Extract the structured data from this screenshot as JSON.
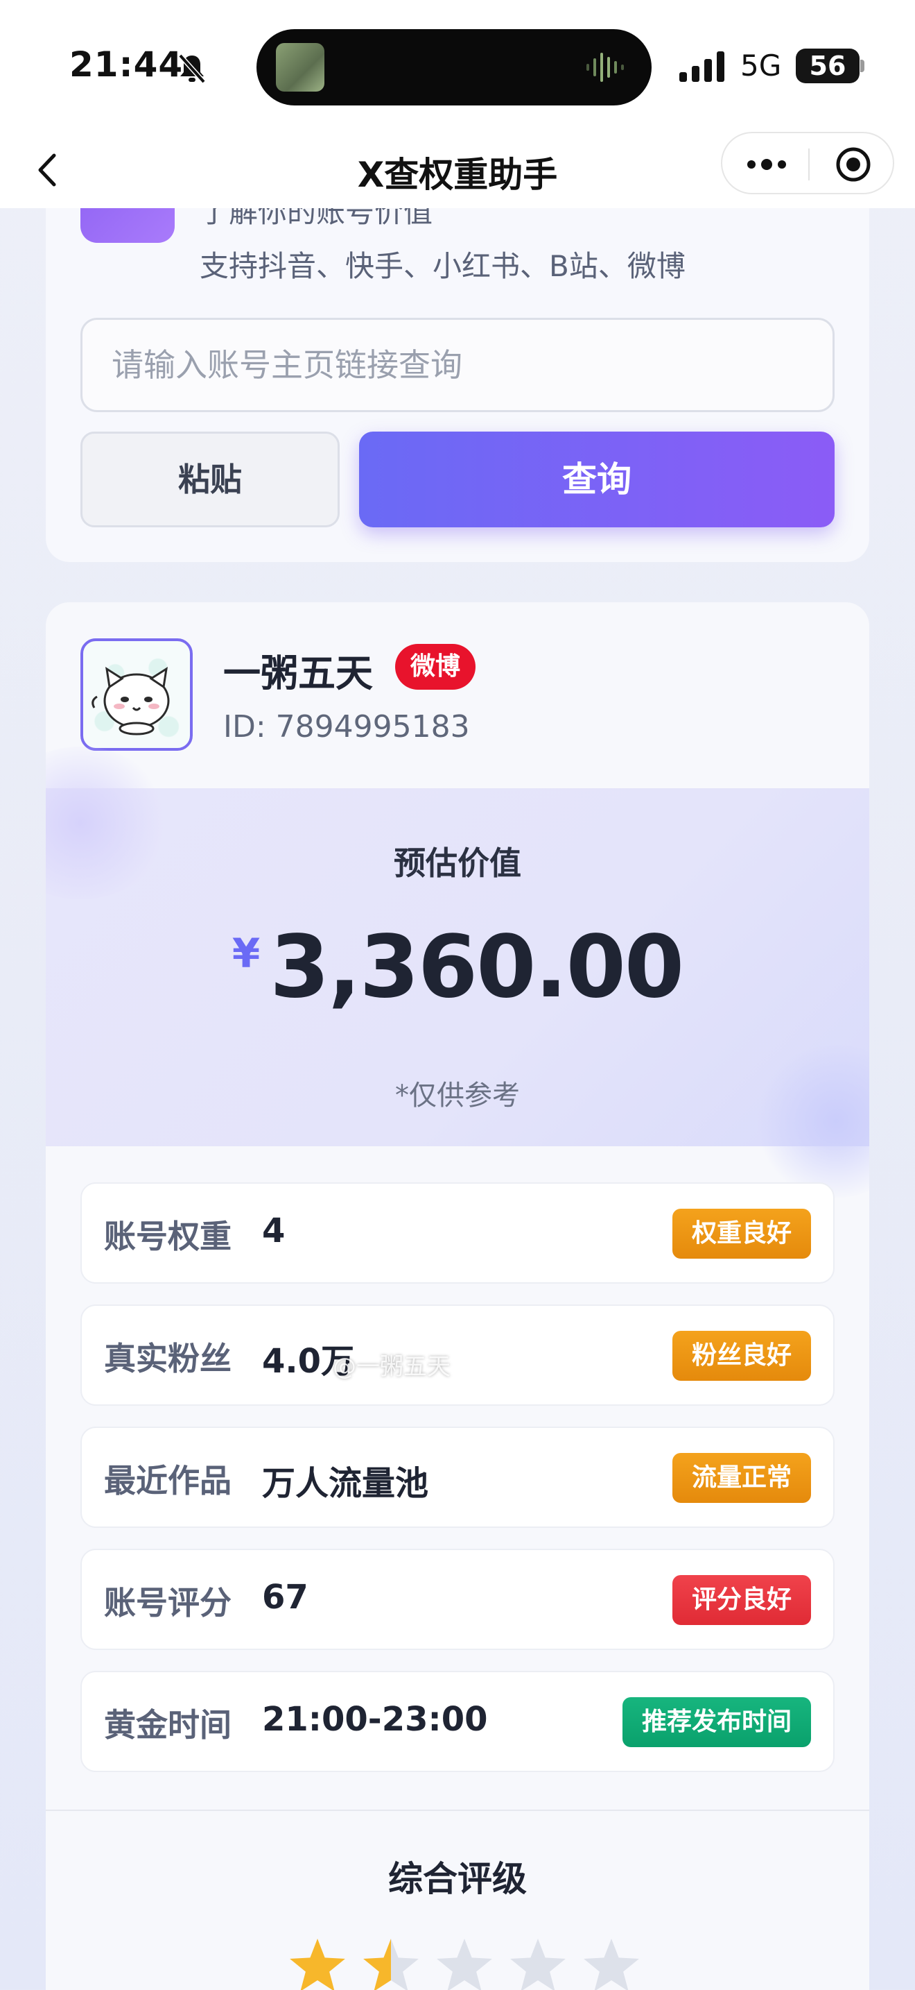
{
  "status_bar": {
    "time": "21:44",
    "network": "5G",
    "battery": "56"
  },
  "nav": {
    "title": "X查权重助手"
  },
  "intro": {
    "line1": "了解你的账号价值",
    "line2": "支持抖音、快手、小红书、B站、微博"
  },
  "search": {
    "placeholder": "请输入账号主页链接查询",
    "value": "",
    "paste_label": "粘贴",
    "query_label": "查询"
  },
  "account": {
    "name": "一粥五天",
    "platform": "微博",
    "id": "ID: 7894995183"
  },
  "valuation": {
    "label": "预估价值",
    "currency": "¥",
    "amount": "3,360.00",
    "note": "*仅供参考"
  },
  "metrics": [
    {
      "label": "账号权重",
      "value": "4",
      "badge": "权重良好",
      "badge_color": "#f19b17"
    },
    {
      "label": "真实粉丝",
      "value": "4.0万",
      "badge": "粉丝良好",
      "badge_color": "#f19b17"
    },
    {
      "label": "最近作品",
      "value": "万人流量池",
      "badge": "流量正常",
      "badge_color": "#f19b17"
    },
    {
      "label": "账号评分",
      "value": "67",
      "badge": "评分良好",
      "badge_color": "#ee3a44"
    },
    {
      "label": "黄金时间",
      "value": "21:00-23:00",
      "badge": "推荐发布时间",
      "badge_color": "#12ad77"
    }
  ],
  "rating": {
    "title": "综合评级",
    "stars_filled": 1.5,
    "stars_total": 5,
    "star_color": "#f7b72b"
  },
  "watermark": "@一粥五天",
  "colors": {
    "accent": "#6a6af5",
    "accent_2": "#8b5cf6",
    "platform_red": "#e8132c"
  }
}
